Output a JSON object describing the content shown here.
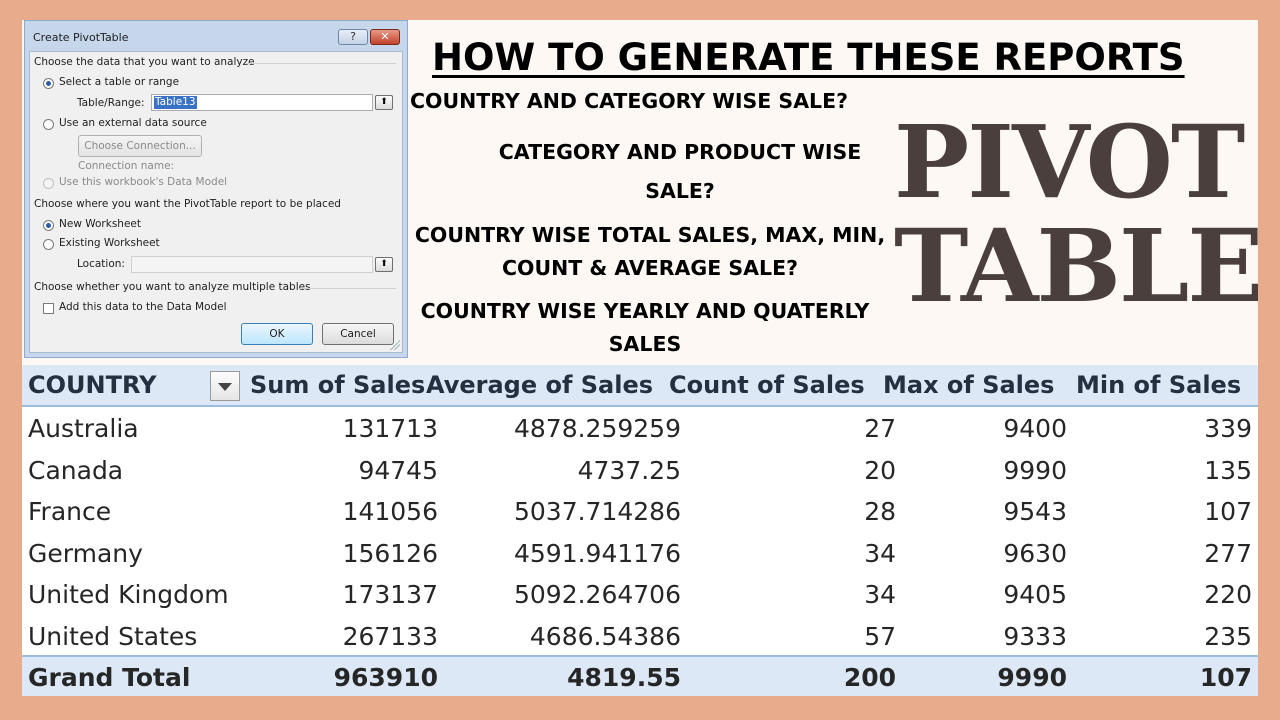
{
  "dialog": {
    "title": "Create PivotTable",
    "help_label": "?",
    "close_label": "✕",
    "section1": "Choose the data that you want to analyze",
    "opt_table": "Select a table or range",
    "table_range_label": "Table/Range:",
    "table_range_value": "Table13",
    "opt_external": "Use an external data source",
    "choose_connection": "Choose Connection...",
    "connection_name": "Connection name:",
    "opt_data_model": "Use this workbook's Data Model",
    "section2": "Choose where you want the PivotTable report to be placed",
    "opt_new_ws": "New Worksheet",
    "opt_existing_ws": "Existing Worksheet",
    "location_label": "Location:",
    "location_value": "",
    "section3": "Choose whether you want to analyze multiple tables",
    "add_data_model": "Add this data to the Data Model",
    "ok": "OK",
    "cancel": "Cancel",
    "collapse_glyph": "⬆"
  },
  "heading": "HOW TO GENERATE THESE REPORTS",
  "questions": [
    "COUNTRY AND CATEGORY WISE SALE?",
    "CATEGORY AND PRODUCT WISE",
    "SALE?",
    "COUNTRY WISE TOTAL SALES, MAX, MIN,",
    "COUNT & AVERAGE SALE?",
    "COUNTRY WISE YEARLY AND QUATERLY",
    "SALES"
  ],
  "big_title": [
    "PIVOT",
    "TABLE"
  ],
  "table": {
    "headers": [
      "COUNTRY",
      "Sum of Sales",
      "Average of Sales",
      "Count of Sales",
      "Max of Sales",
      "Min of Sales"
    ],
    "rows": [
      [
        "Australia",
        "131713",
        "4878.259259",
        "27",
        "9400",
        "339"
      ],
      [
        "Canada",
        "94745",
        "4737.25",
        "20",
        "9990",
        "135"
      ],
      [
        "France",
        "141056",
        "5037.714286",
        "28",
        "9543",
        "107"
      ],
      [
        "Germany",
        "156126",
        "4591.941176",
        "34",
        "9630",
        "277"
      ],
      [
        "United Kingdom",
        "173137",
        "5092.264706",
        "34",
        "9405",
        "220"
      ],
      [
        "United States",
        "267133",
        "4686.54386",
        "57",
        "9333",
        "235"
      ]
    ],
    "total": [
      "Grand Total",
      "963910",
      "4819.55",
      "200",
      "9990",
      "107"
    ]
  }
}
